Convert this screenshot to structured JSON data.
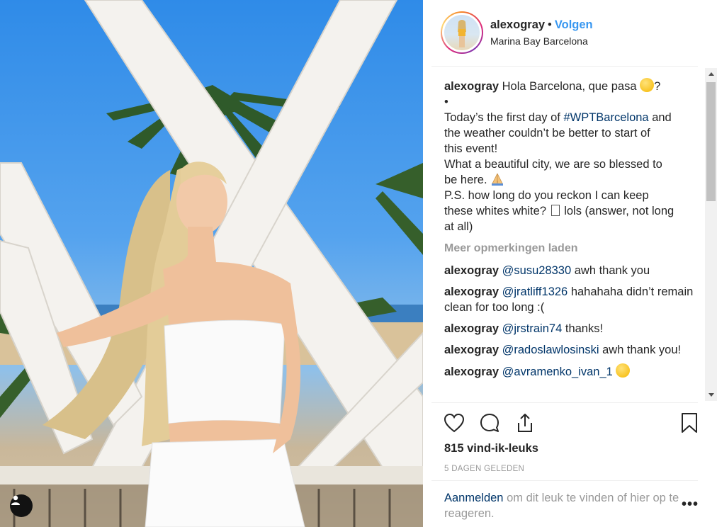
{
  "post": {
    "username": "alexogray",
    "follow_label": "Volgen",
    "separator": "•",
    "location": "Marina Bay Barcelona"
  },
  "caption": {
    "username": "alexogray",
    "line1": "Hola Barcelona, que pasa",
    "line1_end": "?",
    "bullet": "•",
    "line3a": "Today’s the first day of",
    "hashtag": "#WPTBarcelona",
    "line3b": "and",
    "line4": "the weather couldn’t be better to start of",
    "line5": "this event!",
    "line6": "What a beautiful city, we are so blessed to",
    "line7": "be here.",
    "line8": "P.S. how long do you reckon I can keep",
    "line9a": "these whites white?",
    "line9b": "lols (answer, not long",
    "line10": "at all)"
  },
  "load_more_label": "Meer opmerkingen laden",
  "comments": [
    {
      "user": "alexogray",
      "mention": "@susu28330",
      "text": "awh thank you"
    },
    {
      "user": "alexogray",
      "mention": "@jratliff1326",
      "text": "hahahaha didn’t remain clean for too long :("
    },
    {
      "user": "alexogray",
      "mention": "@jrstrain74",
      "text": "thanks!"
    },
    {
      "user": "alexogray",
      "mention": "@radoslawlosinski",
      "text": "awh thank you!"
    },
    {
      "user": "alexogray",
      "mention": "@avramenko_ivan_1",
      "text": ""
    }
  ],
  "likes_label": "815 vind-ik-leuks",
  "date_label": "5 DAGEN GELEDEN",
  "login": {
    "link": "Aanmelden",
    "text": "om dit leuk te vinden of hier op te reageren."
  },
  "more_options": "•••",
  "icons": [
    "heart-icon",
    "comment-icon",
    "share-icon",
    "bookmark-icon",
    "user-tag-icon",
    "scroll-up-icon",
    "scroll-down-icon",
    "more-options-icon"
  ]
}
